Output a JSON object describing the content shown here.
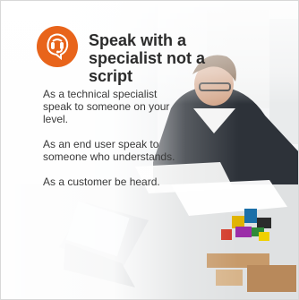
{
  "header": {
    "logo_icon": "headset-speech-bubble-icon",
    "title": "Speak with a specialist not a script"
  },
  "body": {
    "paragraphs": [
      "As a technical specialist speak to someone on your level.",
      "As an end user speak to someone who understands.",
      "As a customer be heard."
    ]
  },
  "colors": {
    "accent": "#e8641b",
    "title_text": "#2b2b2b",
    "body_text": "#3a3a3a"
  }
}
